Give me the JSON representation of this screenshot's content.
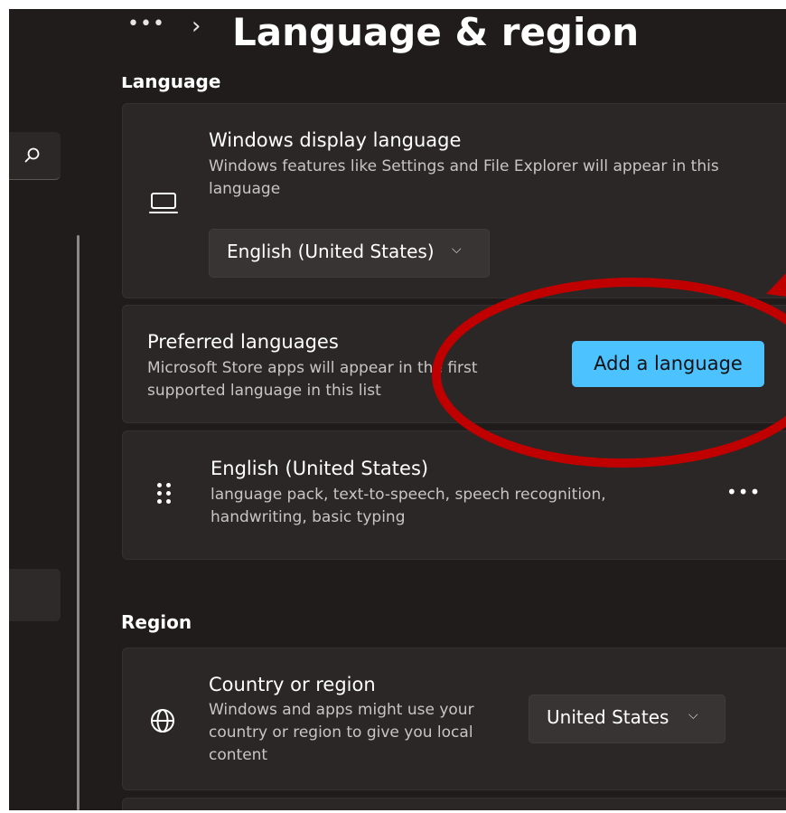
{
  "header": {
    "more": "•••",
    "chevron": "›",
    "title": "Language & region"
  },
  "sections": {
    "language": "Language",
    "region": "Region"
  },
  "display_language": {
    "icon": "laptop-icon",
    "title": "Windows display language",
    "description": "Windows features like Settings and File Explorer will appear in this language",
    "selected": "English (United States)"
  },
  "preferred_languages": {
    "title": "Preferred languages",
    "description": "Microsoft Store apps will appear in the first supported language in this list",
    "add_button": "Add a language"
  },
  "language_item": {
    "icon": "gripper-icon",
    "title": "English (United States)",
    "description": "language pack, text-to-speech, speech recognition, handwriting, basic typing",
    "more": "•••"
  },
  "country_region": {
    "icon": "globe-icon",
    "title": "Country or region",
    "description": "Windows and apps might use your country or region to give you local content",
    "selected": "United States"
  },
  "dropdown_chevron": "⌵",
  "colors": {
    "window_bg": "#1f1c1b",
    "card_bg": "#2a2726",
    "accent": "#4cc2ff",
    "annotation": "#c00000"
  }
}
